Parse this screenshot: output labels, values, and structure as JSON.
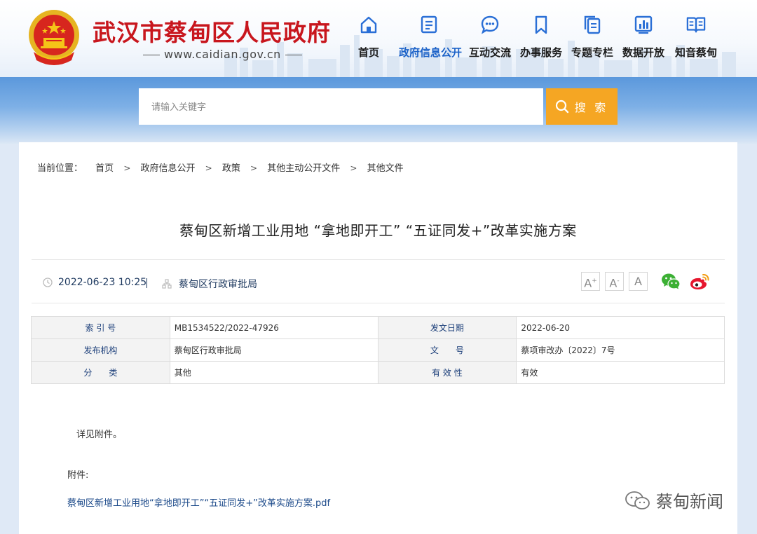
{
  "header": {
    "site_title": "武汉市蔡甸区人民政府",
    "site_url": "www.caidian.gov.cn",
    "nav": [
      {
        "label": "首页",
        "icon": "home-icon"
      },
      {
        "label": "政府信息公开",
        "icon": "document-icon",
        "active": true
      },
      {
        "label": "互动交流",
        "icon": "chat-bubble-icon"
      },
      {
        "label": "办事服务",
        "icon": "bookmark-icon"
      },
      {
        "label": "专题专栏",
        "icon": "files-icon"
      },
      {
        "label": "数据开放",
        "icon": "bar-chart-icon"
      },
      {
        "label": "知音蔡甸",
        "icon": "open-book-icon"
      }
    ]
  },
  "search": {
    "placeholder": "请输入关键字",
    "button_label": "搜 索"
  },
  "breadcrumb": {
    "lead": "当前位置：",
    "items": [
      "首页",
      "政府信息公开",
      "政策",
      "其他主动公开文件",
      "其他文件"
    ],
    "separator": ">"
  },
  "article": {
    "title": "蔡甸区新增工业用地 “拿地即开工” “五证同发+”改革实施方案",
    "datetime": "2022-06-23 10:25",
    "meta_divider": "|",
    "org": "蔡甸区行政审批局",
    "font_sizes": [
      "A+",
      "A-",
      "A"
    ],
    "share": [
      "wechat-icon",
      "weibo-icon"
    ]
  },
  "info_table": [
    [
      {
        "key": "索 引 号",
        "value": "MB1534522/2022-47926"
      },
      {
        "key": "发文日期",
        "value": "2022-06-20"
      }
    ],
    [
      {
        "key": "发布机构",
        "value": "蔡甸区行政审批局"
      },
      {
        "key": "文　　号",
        "value": "蔡项审改办〔2022〕7号"
      }
    ],
    [
      {
        "key": "分　　类",
        "value": "其他"
      },
      {
        "key": "有 效 性",
        "value": "有效"
      }
    ]
  ],
  "body": {
    "text": "详见附件。",
    "attachment_label": "附件:",
    "attachment_link": "蔡甸区新增工业用地“拿地即开工”“五证同发+”改革实施方案.pdf"
  },
  "watermark": "蔡甸新闻",
  "colors": {
    "title_red": "#c8161d",
    "nav_active": "#1c62c8",
    "search_button": "#f5a623",
    "band_blue": "#5b98dc"
  }
}
